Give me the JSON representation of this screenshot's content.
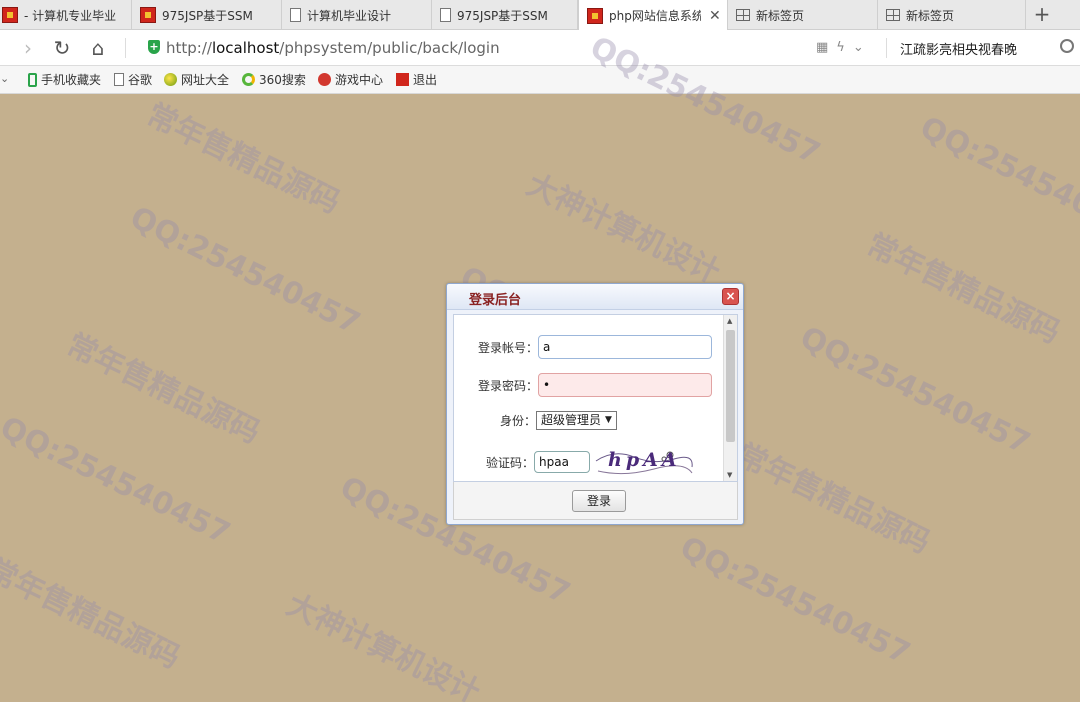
{
  "tabs": [
    {
      "label": "- 计算机专业毕业",
      "icon": "red-favicon-icon",
      "active": false
    },
    {
      "label": "975JSP基于SSM",
      "icon": "red-favicon-icon",
      "active": false
    },
    {
      "label": "计算机毕业设计",
      "icon": "page-icon",
      "active": false
    },
    {
      "label": "975JSP基于SSM",
      "icon": "page-icon",
      "active": false
    },
    {
      "label": "php网站信息系统",
      "icon": "red-favicon-icon",
      "active": true
    },
    {
      "label": "新标签页",
      "icon": "grid-icon",
      "active": false
    },
    {
      "label": "新标签页",
      "icon": "grid-icon",
      "active": false
    }
  ],
  "address": {
    "url_prefix": "http://",
    "url_host": "localhost",
    "url_path": "/phpsystem/public/back/login",
    "news_text": "江疏影亮相央视春晚"
  },
  "bookmarks": [
    {
      "label": "手机收藏夹",
      "icon": "phone-icon"
    },
    {
      "label": "谷歌",
      "icon": "page-icon"
    },
    {
      "label": "网址大全",
      "icon": "globe-icon"
    },
    {
      "label": "360搜索",
      "icon": "search-360-icon"
    },
    {
      "label": "游戏中心",
      "icon": "game-icon"
    },
    {
      "label": "退出",
      "icon": "exit-icon"
    }
  ],
  "dialog": {
    "title": "登录后台",
    "close_symbol": "×",
    "account_label": "登录帐号：",
    "account_value": "a",
    "password_label": "登录密码：",
    "password_value": "•",
    "role_label": "身份：",
    "role_selected": "超级管理员",
    "captcha_label": "验证码：",
    "captcha_value": "hpaa",
    "captcha_image_text": "hpAA",
    "submit_label": "登录"
  },
  "watermark": {
    "qq": "QQ:254540457",
    "slogan_1": "常年售精品源码",
    "slogan_2": "大神计算机设计"
  },
  "colors": {
    "desktop_bg": "#c4b08e",
    "dialog_title": "#8a2222",
    "shield_green": "#29a44a"
  }
}
